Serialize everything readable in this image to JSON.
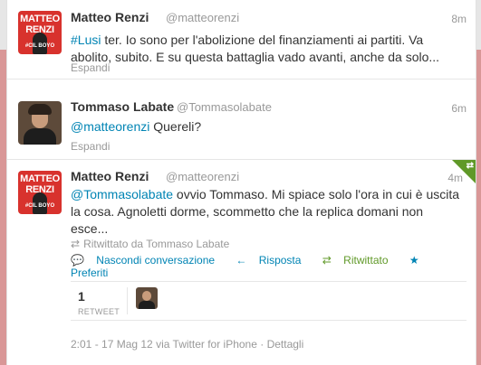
{
  "tweets": [
    {
      "name": "Matteo Renzi",
      "handle": "@matteorenzi",
      "time": "8m",
      "hashtag": "#Lusi",
      "text": " ter. Io sono per l'abolizione del finanziamenti ai partiti. Va abolito, subito. E su questa battaglia vado avanti, anche da solo...",
      "expand": "Espandi",
      "avatar_lines": [
        "MATTEO",
        "RENZI"
      ],
      "avatar_sub": "#CIL BOYO"
    },
    {
      "name": "Tommaso Labate",
      "handle": "@Tommasolabate",
      "time": "6m",
      "mention": "@matteorenzi",
      "text": " Quereli?",
      "expand": "Espandi"
    },
    {
      "name": "Matteo Renzi",
      "handle": "@matteorenzi",
      "time": "4m",
      "mention": "@Tommasolabate",
      "text": " ovvio Tommaso. Mi spiace solo l'ora in cui è uscita la cosa. Agnoletti dorme, scommetto che la replica domani non esce...",
      "retweeted_by": "Ritwittato da Tommaso Labate",
      "actions": {
        "hide": "Nascondi conversazione",
        "reply": "Risposta",
        "retweeted": "Ritwittato",
        "favorite": "Preferiti"
      },
      "stats": {
        "count": "1",
        "label": "RETWEET"
      },
      "footer": {
        "datetime": "2:01 - 17 Mag 12",
        "via": " via Twitter for iPhone",
        "sep": " · ",
        "details": "Dettagli"
      },
      "avatar_lines": [
        "MATTEO",
        "RENZI"
      ],
      "avatar_sub": "#CIL BOYO"
    }
  ],
  "icons": {
    "retweet": "retweet-icon",
    "reply": "reply-icon",
    "favorite": "star-icon",
    "hide": "chat-icon"
  },
  "colors": {
    "link": "#0084b4",
    "retweeted": "#609928",
    "renzi_red": "#d8322d",
    "background": "#d99797"
  }
}
